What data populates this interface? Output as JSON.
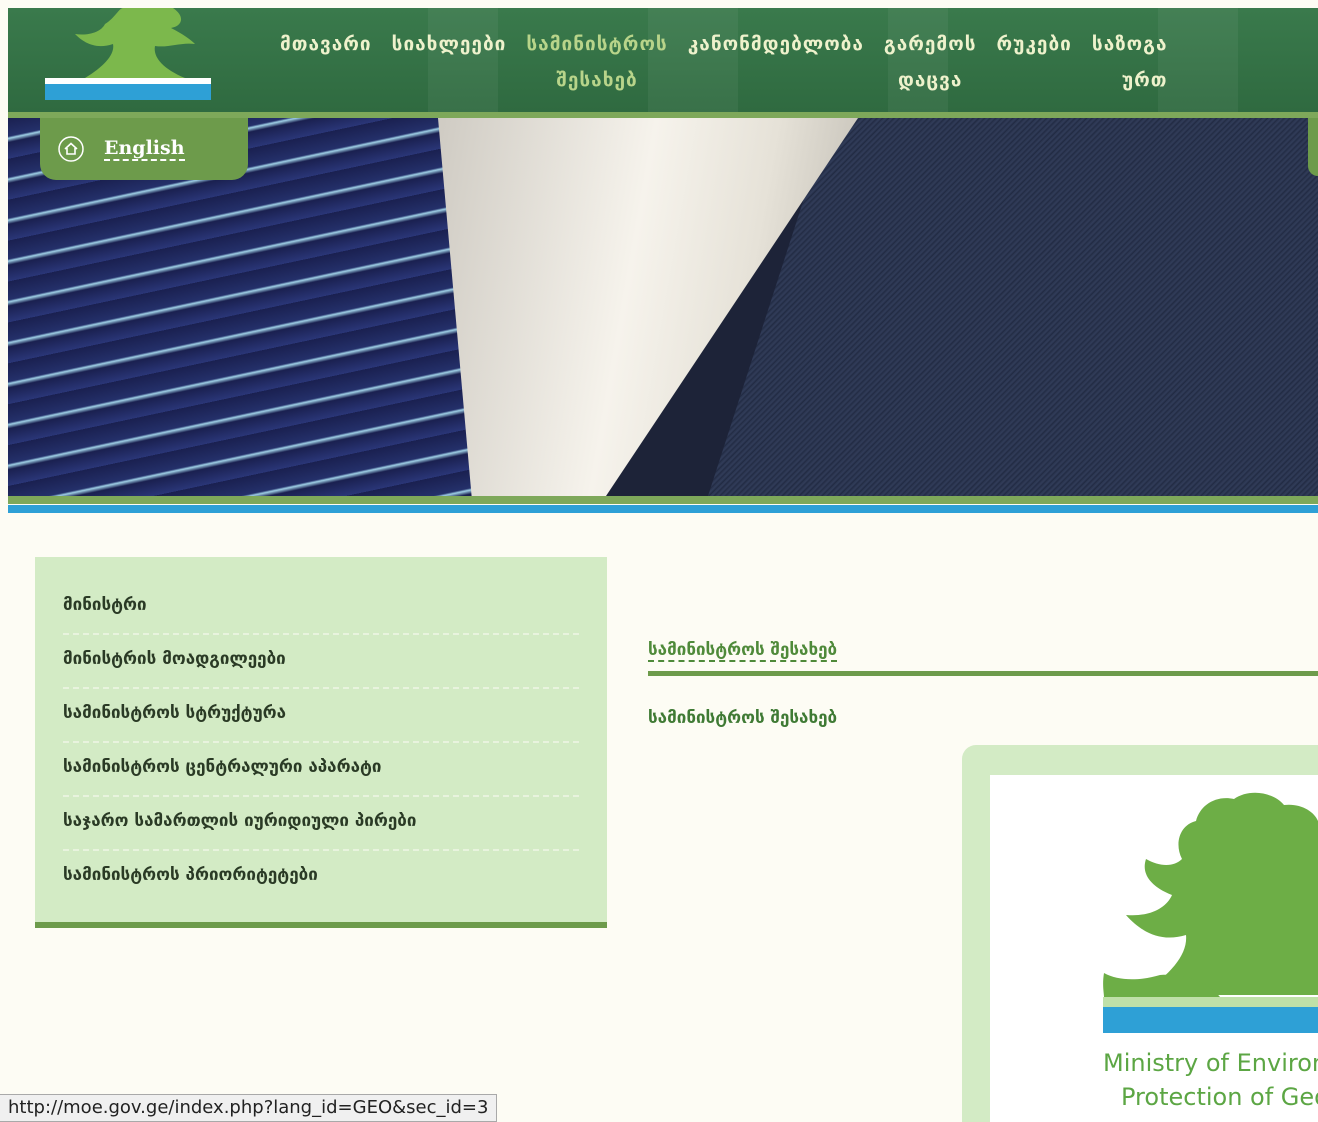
{
  "header": {
    "nav_items": [
      {
        "line1": "მთავარი",
        "line2": ""
      },
      {
        "line1": "სიახლეები",
        "line2": ""
      },
      {
        "line1": "სამინისტროს",
        "line2": "შესახებ"
      },
      {
        "line1": "კანონმდებლობა",
        "line2": ""
      },
      {
        "line1": "გარემოს",
        "line2": "დაცვა"
      },
      {
        "line1": "რუკები",
        "line2": ""
      },
      {
        "line1": "საზოგა",
        "line2": "ურთ"
      }
    ],
    "active_index": 2
  },
  "lang_tab": {
    "link": "English",
    "icon": "home-icon"
  },
  "banner": {
    "icon": "fabric-photo"
  },
  "sidebar": {
    "items": [
      "მინისტრი",
      "მინისტრის მოადგილეები",
      "სამინისტროს სტრუქტურა",
      "სამინისტროს ცენტრალური აპარატი",
      "საჯარო სამართლის იურიდიული პირები",
      "სამინისტროს პრიორიტეტები"
    ]
  },
  "main": {
    "breadcrumb": "სამინისტროს შესახებ",
    "title": "სამინისტროს შესახებ",
    "image_text_line1": "Ministry of Environ",
    "image_text_line2": "Protection of Geo"
  },
  "statusbar": {
    "url": "http://moe.gov.ge/index.php?lang_id=GEO&sec_id=3"
  },
  "colors": {
    "header_green": "#3a7a4c",
    "accent_green": "#6d9b4b",
    "light_green": "#d3ebc5",
    "blue_line": "#2ea0d6",
    "background": "#fdfcf4"
  }
}
